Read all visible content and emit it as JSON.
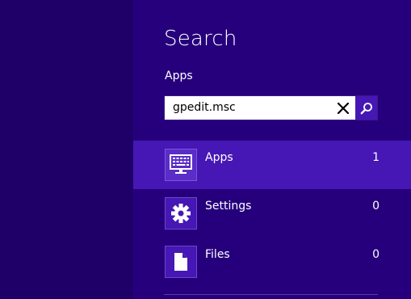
{
  "charm": {
    "title": "Search",
    "scope": "Apps",
    "search": {
      "value": "gpedit.msc",
      "placeholder": ""
    }
  },
  "categories": [
    {
      "label": "Apps",
      "count": "1",
      "icon": "apps-icon",
      "selected": true
    },
    {
      "label": "Settings",
      "count": "0",
      "icon": "gear-icon",
      "selected": false
    },
    {
      "label": "Files",
      "count": "0",
      "icon": "file-icon",
      "selected": false
    }
  ],
  "colors": {
    "background": "#1f0068",
    "charm_background": "#26007c",
    "accent": "#4617b4"
  }
}
